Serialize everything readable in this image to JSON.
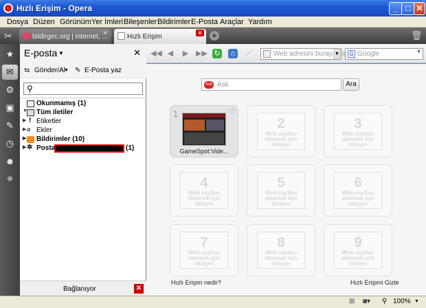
{
  "window": {
    "title": "Hızlı Erişim - Opera"
  },
  "menu": [
    "Dosya",
    "Düzen",
    "Görünüm",
    "Yer İmleri",
    "Bileşenler",
    "Bildirimler",
    "E-Posta",
    "Araçlar",
    "Yardım"
  ],
  "tabs": [
    {
      "label": "bildirgec.org | internet, ..."
    },
    {
      "label": "Hızlı Erişim"
    }
  ],
  "mail_panel": {
    "title": "E-posta",
    "send_receive": "Gönder/Al",
    "compose": "E-Posta yaz",
    "tree": [
      {
        "label": "Okunmamış (1)"
      },
      {
        "label": "Tüm iletiler"
      },
      {
        "label": "Etiketler"
      },
      {
        "label": "Ekler"
      },
      {
        "label": "Bildirimler (10)"
      },
      {
        "label": "Posta",
        "count": "(1)"
      }
    ],
    "footer": "Bağlanıyor"
  },
  "nav": {
    "address_placeholder": "Web adresini buraya gir",
    "search_placeholder": "Google"
  },
  "speed_dial": {
    "ask_placeholder": "Ask",
    "ask_button": "Ara",
    "ask_logo": "Ask",
    "cells": [
      {
        "num": "1",
        "caption": "GameSpot:Vide..."
      },
      {
        "num": "2",
        "text": "Web sayfası eklemek için tıklayın"
      },
      {
        "num": "3",
        "text": "Web sayfası eklemek için tıklayın"
      },
      {
        "num": "4",
        "text": "Web sayfası eklemek için tıklayın"
      },
      {
        "num": "5",
        "text": "Web sayfası eklemek için tıklayın"
      },
      {
        "num": "6",
        "text": "Web sayfası eklemek için tıklayın"
      },
      {
        "num": "7",
        "text": "Web sayfası eklemek için tıklayın"
      },
      {
        "num": "8",
        "text": "Web sayfası eklemek için tıklayın"
      },
      {
        "num": "9",
        "text": "Web sayfası eklemek için tıklayın"
      }
    ],
    "help_link": "Hızlı Erişim nedir?",
    "hide_link": "Hızlı Erişimi Gizle"
  },
  "status": {
    "zoom": "100%"
  }
}
